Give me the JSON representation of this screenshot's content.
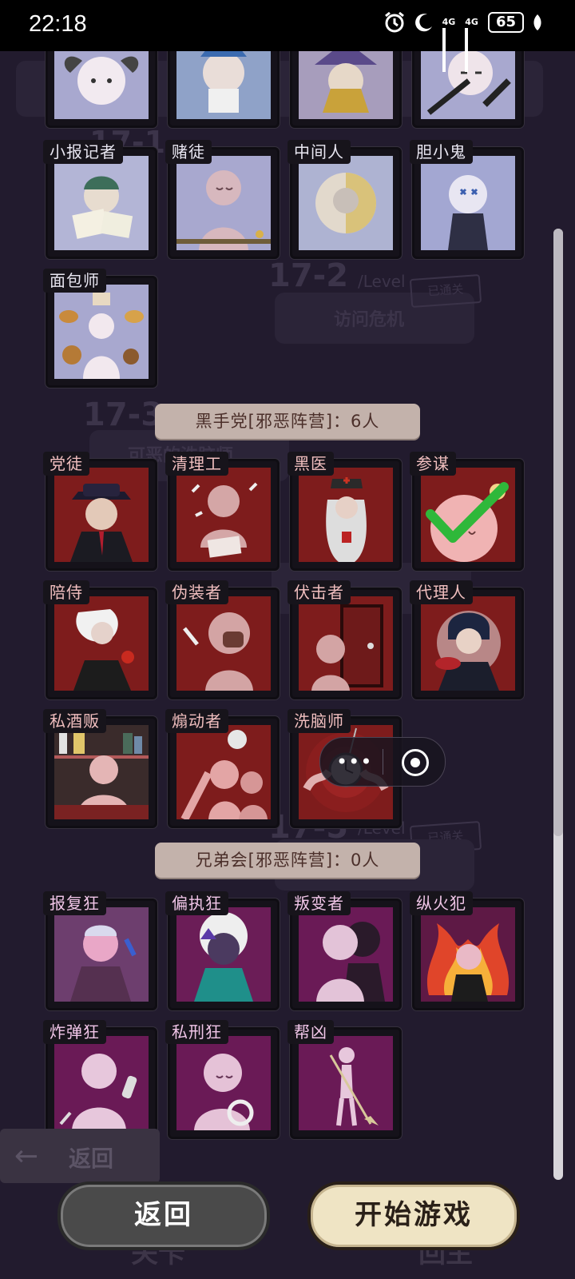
{
  "status_bar": {
    "time": "22:18",
    "network_1": "4G",
    "network_2": "4G",
    "battery": "65",
    "icons": [
      "alarm-icon",
      "moon-icon",
      "signal-icon",
      "signal-icon",
      "battery-icon",
      "leaf-icon"
    ]
  },
  "background_levels": {
    "level_a_number": "17-1",
    "level_b_number": "17-2",
    "level_b_suffix": "/Level",
    "level_b_title": "访问危机",
    "level_c_number": "17-3",
    "level_c_title": "可恶的洗脑师",
    "level_e_number": "17-5",
    "level_e_suffix": "/Level",
    "stamp": "已通关",
    "back_label": "返回",
    "bottom_left_ghost": "关卡",
    "bottom_right_ghost": "回主"
  },
  "good_roles": {
    "top_row": [
      "",
      "",
      "",
      ""
    ],
    "row2": [
      "小报记者",
      "赌徒",
      "中间人",
      "胆小鬼"
    ],
    "row3": [
      "面包师"
    ]
  },
  "sections": {
    "black_hand": "黑手党[邪恶阵营]：6人",
    "brotherhood": "兄弟会[邪恶阵营]：0人"
  },
  "mafia_roles": [
    "党徒",
    "清理工",
    "黑医",
    "参谋",
    "陪侍",
    "伪装者",
    "伏击者",
    "代理人",
    "私酒贩",
    "煽动者",
    "洗脑师"
  ],
  "brotherhood_roles": [
    "报复狂",
    "偏执狂",
    "叛变者",
    "纵火犯",
    "炸弹狂",
    "私刑狂",
    "帮凶"
  ],
  "selected_role": "参谋",
  "buttons": {
    "back": "返回",
    "start": "开始游戏"
  },
  "colors": {
    "good_bg": "#a8a8cf",
    "mafia_bg": "#7e1c1c",
    "brotherhood_bg": "#6a1a56",
    "check": "#2fb83a"
  }
}
